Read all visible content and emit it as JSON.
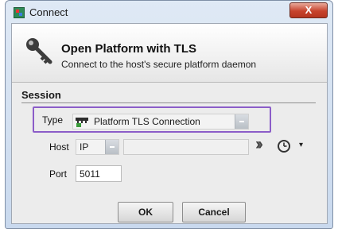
{
  "window": {
    "title": "Connect",
    "close_glyph": "X"
  },
  "header": {
    "title": "Open Platform with TLS",
    "subtitle": "Connect to the host's secure platform daemon",
    "icon": "key-icon"
  },
  "session": {
    "section_label": "Session",
    "type_label": "Type",
    "type_value": "Platform TLS Connection",
    "type_icon": "connection-icon",
    "highlight_color": "#8b5dc8",
    "host_label": "Host",
    "host_mode": "IP",
    "host_value": "",
    "port_label": "Port",
    "port_value": "5011"
  },
  "buttons": {
    "ok": "OK",
    "cancel": "Cancel"
  }
}
